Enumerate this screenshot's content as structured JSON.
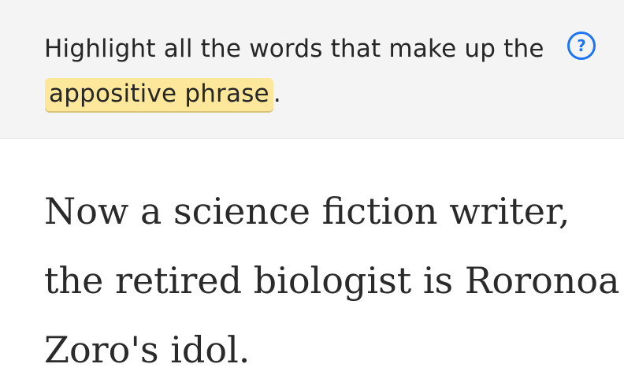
{
  "prompt": {
    "text_before": "Highlight all the words that make up the ",
    "highlight": "appositive phrase",
    "text_after": ".",
    "help_icon": "question-circle-icon",
    "help_glyph": "?"
  },
  "sentence": {
    "lines": [
      [
        "Now",
        "a",
        "science",
        "fiction",
        "writer,"
      ],
      [
        "the",
        "retired",
        "biologist",
        "is",
        "Roronoa"
      ],
      [
        "Zoro's",
        "idol."
      ]
    ]
  },
  "colors": {
    "accent": "#1d74f5",
    "highlight": "#fde79a",
    "prompt_bg": "#f4f4f4",
    "text": "#2a2a2a"
  }
}
